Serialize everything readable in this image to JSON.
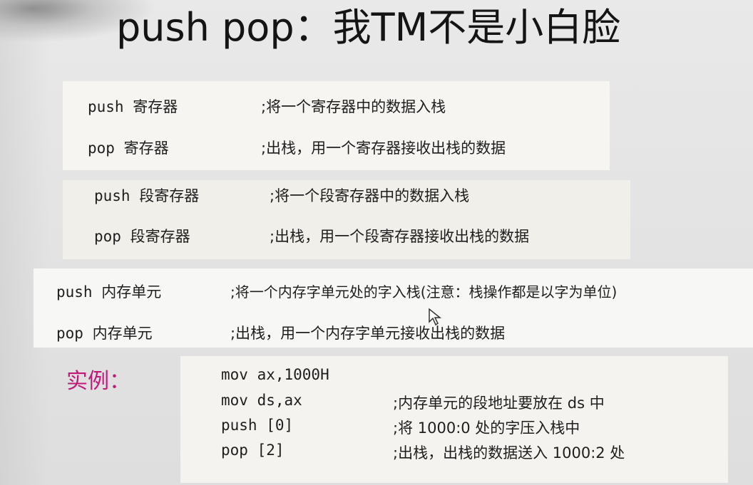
{
  "slide": {
    "title": "push pop：我TM不是小白脸",
    "groups": [
      {
        "rows": [
          {
            "code": "push 寄存器",
            "comment": ";将一个寄存器中的数据入栈"
          },
          {
            "code": "pop 寄存器",
            "comment": ";出栈，用一个寄存器接收出栈的数据"
          }
        ]
      },
      {
        "rows": [
          {
            "code": "push 段寄存器",
            "comment": ";将一个段寄存器中的数据入栈"
          },
          {
            "code": "pop 段寄存器",
            "comment": ";出栈，用一个段寄存器接收出栈的数据"
          }
        ]
      },
      {
        "rows": [
          {
            "code": "push 内存单元",
            "comment": ";将一个内存字单元处的字入栈(注意：栈操作都是以字为单位)"
          },
          {
            "code": "pop 内存单元",
            "comment": ";出栈，用一个内存字单元接收出栈的数据"
          }
        ]
      }
    ],
    "example": {
      "label": "实例：",
      "lines": [
        {
          "code": "mov ax,1000H",
          "comment": ""
        },
        {
          "code": "mov ds,ax",
          "comment": ";内存单元的段地址要放在 ds 中"
        },
        {
          "code": "push [0]",
          "comment": ";将 1000:0 处的字压入栈中"
        },
        {
          "code": "pop [2]",
          "comment": ";出栈，出栈的数据送入 1000:2 处"
        }
      ]
    },
    "colors": {
      "example_label": "#c0197a",
      "title": "#141414"
    }
  }
}
